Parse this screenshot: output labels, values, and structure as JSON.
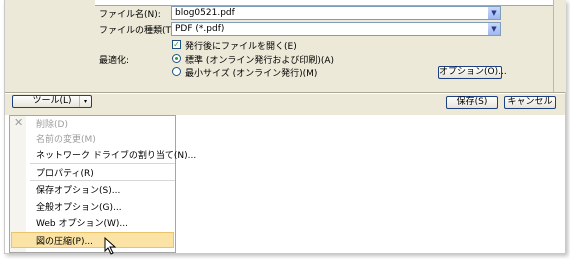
{
  "form": {
    "filename_label": "ファイル名(N):",
    "filename_value": "blog0521.pdf",
    "filetype_label": "ファイルの種類(T):",
    "filetype_value": "PDF (*.pdf)",
    "open_after_label": "発行後にファイルを開く(E)",
    "open_after_checked": true,
    "optimize_label": "最適化:",
    "standard_option": "標準 (オンライン発行および印刷)(A)",
    "minimum_option": "最小サイズ (オンライン発行)(M)",
    "selected_option": "standard",
    "options_button": "オプション(O)..."
  },
  "footer": {
    "tools_button": "ツール(L)",
    "save_button": "保存(S)",
    "cancel_button": "キャンセル"
  },
  "tools_menu": {
    "items": [
      {
        "label": "削除(D)",
        "disabled": true
      },
      {
        "label": "名前の変更(M)",
        "disabled": true
      },
      {
        "label": "ネットワーク ドライブの割り当て(N)...",
        "disabled": false
      },
      {
        "label": "プロパティ(R)",
        "disabled": false
      },
      {
        "label": "保存オプション(S)...",
        "disabled": false
      },
      {
        "label": "全般オプション(G)...",
        "disabled": false
      },
      {
        "label": "Web オプション(W)...",
        "disabled": false
      },
      {
        "label": "図の圧縮(P)...",
        "disabled": false,
        "highlighted": true
      }
    ]
  }
}
